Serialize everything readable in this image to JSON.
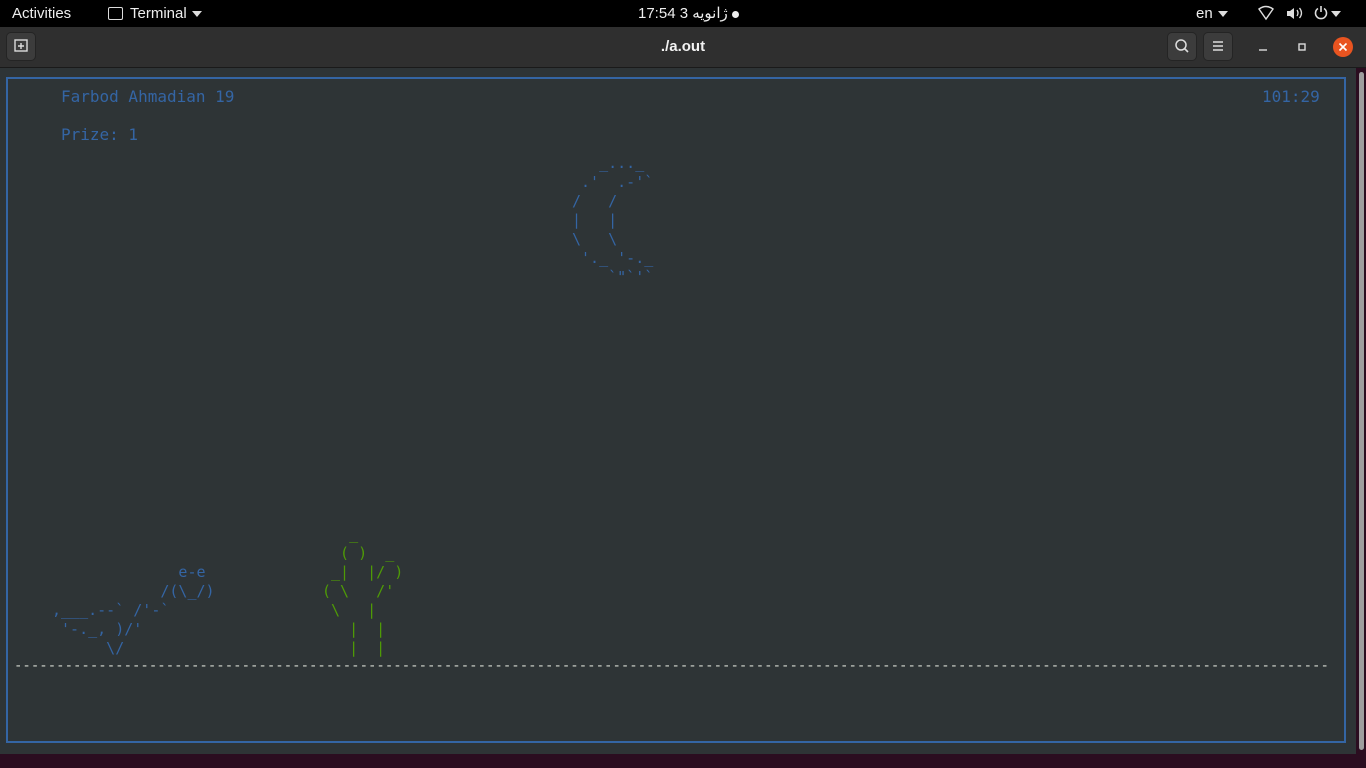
{
  "topbar": {
    "activities": "Activities",
    "app_name": "Terminal",
    "clock": "17:54  3 ژانویه",
    "keyboard_layout": "en",
    "icons": [
      "wifi-icon",
      "volume-icon",
      "power-icon"
    ]
  },
  "window": {
    "title": "./a.out",
    "buttons": [
      "new-tab-icon",
      "search-icon",
      "menu-icon",
      "minimize-icon",
      "maximize-icon",
      "close-icon"
    ]
  },
  "game": {
    "player": "Farbod Ahmadian 19",
    "timer": "101:29",
    "prize": "Prize: 1",
    "moon_art": "   _..._\n .'  .-'`\n/   /\n|   |\n\\   \\\n '._ '-._\n    `\"`'`",
    "dino_art": "              e-e\n            /(\\_/)\n,___.--` /'-`\n '-._, )/'\n      \\/",
    "cactus_art": "   _\n  ( )  _\n _|  |/ )\n( \\   /'\n \\   |\n   |  |\n   |  |",
    "ground": "------------------------------------------------------------------------------------------------------------------------------------------------------------------------------------------------"
  },
  "colors": {
    "terminal_bg": "#2e3436",
    "frame": "#3465a4",
    "text_blue": "#3465a4",
    "cactus_green": "#4e9a06",
    "close_button": "#e95420",
    "desktop_bg": "#2b0d20"
  }
}
